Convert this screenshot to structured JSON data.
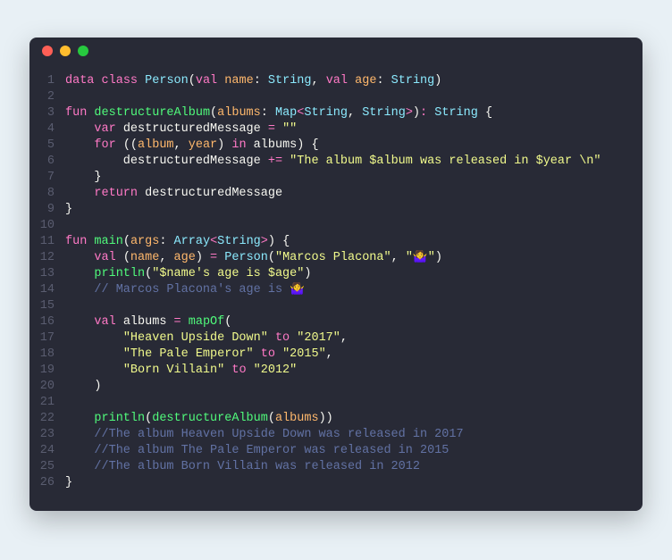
{
  "code": {
    "lines": [
      {
        "n": 1,
        "t": [
          [
            "kw",
            "data"
          ],
          [
            "punct",
            " "
          ],
          [
            "kw",
            "class"
          ],
          [
            "punct",
            " "
          ],
          [
            "cls",
            "Person"
          ],
          [
            "punct",
            "("
          ],
          [
            "kw",
            "val"
          ],
          [
            "punct",
            " "
          ],
          [
            "param",
            "name"
          ],
          [
            "punct",
            ": "
          ],
          [
            "cls",
            "String"
          ],
          [
            "punct",
            ", "
          ],
          [
            "kw",
            "val"
          ],
          [
            "punct",
            " "
          ],
          [
            "param",
            "age"
          ],
          [
            "punct",
            ": "
          ],
          [
            "cls",
            "String"
          ],
          [
            "punct",
            ")"
          ]
        ]
      },
      {
        "n": 2,
        "t": []
      },
      {
        "n": 3,
        "t": [
          [
            "kw",
            "fun"
          ],
          [
            "punct",
            " "
          ],
          [
            "fn",
            "destructureAlbum"
          ],
          [
            "punct",
            "("
          ],
          [
            "param",
            "albums"
          ],
          [
            "punct",
            ": "
          ],
          [
            "cls",
            "Map"
          ],
          [
            "op",
            "<"
          ],
          [
            "cls",
            "String"
          ],
          [
            "punct",
            ", "
          ],
          [
            "cls",
            "String"
          ],
          [
            "op",
            ">"
          ],
          [
            "punct",
            ")"
          ],
          [
            "op",
            ":"
          ],
          [
            "punct",
            " "
          ],
          [
            "cls",
            "String"
          ],
          [
            "punct",
            " {"
          ]
        ]
      },
      {
        "n": 4,
        "t": [
          [
            "punct",
            "    "
          ],
          [
            "kw",
            "var"
          ],
          [
            "punct",
            " destructuredMessage "
          ],
          [
            "op",
            "="
          ],
          [
            "punct",
            " "
          ],
          [
            "str",
            "\"\""
          ]
        ]
      },
      {
        "n": 5,
        "t": [
          [
            "punct",
            "    "
          ],
          [
            "kw",
            "for"
          ],
          [
            "punct",
            " (("
          ],
          [
            "param",
            "album"
          ],
          [
            "punct",
            ", "
          ],
          [
            "param",
            "year"
          ],
          [
            "punct",
            ") "
          ],
          [
            "kw",
            "in"
          ],
          [
            "punct",
            " albums) {"
          ]
        ]
      },
      {
        "n": 6,
        "t": [
          [
            "punct",
            "        destructuredMessage "
          ],
          [
            "op",
            "+="
          ],
          [
            "punct",
            " "
          ],
          [
            "str",
            "\"The album $album was released in $year \\n\""
          ]
        ]
      },
      {
        "n": 7,
        "t": [
          [
            "punct",
            "    }"
          ]
        ]
      },
      {
        "n": 8,
        "t": [
          [
            "punct",
            "    "
          ],
          [
            "kw",
            "return"
          ],
          [
            "punct",
            " destructuredMessage"
          ]
        ]
      },
      {
        "n": 9,
        "t": [
          [
            "punct",
            "}"
          ]
        ]
      },
      {
        "n": 10,
        "t": []
      },
      {
        "n": 11,
        "t": [
          [
            "kw",
            "fun"
          ],
          [
            "punct",
            " "
          ],
          [
            "fn",
            "main"
          ],
          [
            "punct",
            "("
          ],
          [
            "param",
            "args"
          ],
          [
            "punct",
            ": "
          ],
          [
            "cls",
            "Array"
          ],
          [
            "op",
            "<"
          ],
          [
            "cls",
            "String"
          ],
          [
            "op",
            ">"
          ],
          [
            "punct",
            ") {"
          ]
        ]
      },
      {
        "n": 12,
        "t": [
          [
            "punct",
            "    "
          ],
          [
            "kw",
            "val"
          ],
          [
            "punct",
            " ("
          ],
          [
            "param",
            "name"
          ],
          [
            "punct",
            ", "
          ],
          [
            "param",
            "age"
          ],
          [
            "punct",
            ") "
          ],
          [
            "op",
            "="
          ],
          [
            "punct",
            " "
          ],
          [
            "cls",
            "Person"
          ],
          [
            "punct",
            "("
          ],
          [
            "str",
            "\"Marcos Placona\""
          ],
          [
            "punct",
            ", "
          ],
          [
            "str",
            "\"🤷‍♀️\""
          ],
          [
            "punct",
            ")"
          ]
        ]
      },
      {
        "n": 13,
        "t": [
          [
            "punct",
            "    "
          ],
          [
            "fn",
            "println"
          ],
          [
            "punct",
            "("
          ],
          [
            "str",
            "\"$name's age is $age\""
          ],
          [
            "punct",
            ")"
          ]
        ]
      },
      {
        "n": 14,
        "t": [
          [
            "punct",
            "    "
          ],
          [
            "cmt",
            "// Marcos Placona's age is 🤷‍♀️"
          ]
        ]
      },
      {
        "n": 15,
        "t": []
      },
      {
        "n": 16,
        "t": [
          [
            "punct",
            "    "
          ],
          [
            "kw",
            "val"
          ],
          [
            "punct",
            " albums "
          ],
          [
            "op",
            "="
          ],
          [
            "punct",
            " "
          ],
          [
            "fn",
            "mapOf"
          ],
          [
            "punct",
            "("
          ]
        ]
      },
      {
        "n": 17,
        "t": [
          [
            "punct",
            "        "
          ],
          [
            "str",
            "\"Heaven Upside Down\""
          ],
          [
            "punct",
            " "
          ],
          [
            "kw",
            "to"
          ],
          [
            "punct",
            " "
          ],
          [
            "str",
            "\"2017\""
          ],
          [
            "punct",
            ","
          ]
        ]
      },
      {
        "n": 18,
        "t": [
          [
            "punct",
            "        "
          ],
          [
            "str",
            "\"The Pale Emperor\""
          ],
          [
            "punct",
            " "
          ],
          [
            "kw",
            "to"
          ],
          [
            "punct",
            " "
          ],
          [
            "str",
            "\"2015\""
          ],
          [
            "punct",
            ","
          ]
        ]
      },
      {
        "n": 19,
        "t": [
          [
            "punct",
            "        "
          ],
          [
            "str",
            "\"Born Villain\""
          ],
          [
            "punct",
            " "
          ],
          [
            "kw",
            "to"
          ],
          [
            "punct",
            " "
          ],
          [
            "str",
            "\"2012\""
          ]
        ]
      },
      {
        "n": 20,
        "t": [
          [
            "punct",
            "    )"
          ]
        ]
      },
      {
        "n": 21,
        "t": []
      },
      {
        "n": 22,
        "t": [
          [
            "punct",
            "    "
          ],
          [
            "fn",
            "println"
          ],
          [
            "punct",
            "("
          ],
          [
            "fn",
            "destructureAlbum"
          ],
          [
            "punct",
            "("
          ],
          [
            "param",
            "albums"
          ],
          [
            "punct",
            "))"
          ]
        ]
      },
      {
        "n": 23,
        "t": [
          [
            "punct",
            "    "
          ],
          [
            "cmt",
            "//The album Heaven Upside Down was released in 2017"
          ]
        ]
      },
      {
        "n": 24,
        "t": [
          [
            "punct",
            "    "
          ],
          [
            "cmt",
            "//The album The Pale Emperor was released in 2015"
          ]
        ]
      },
      {
        "n": 25,
        "t": [
          [
            "punct",
            "    "
          ],
          [
            "cmt",
            "//The album Born Villain was released in 2012"
          ]
        ]
      },
      {
        "n": 26,
        "t": [
          [
            "punct",
            "}"
          ]
        ]
      }
    ]
  }
}
